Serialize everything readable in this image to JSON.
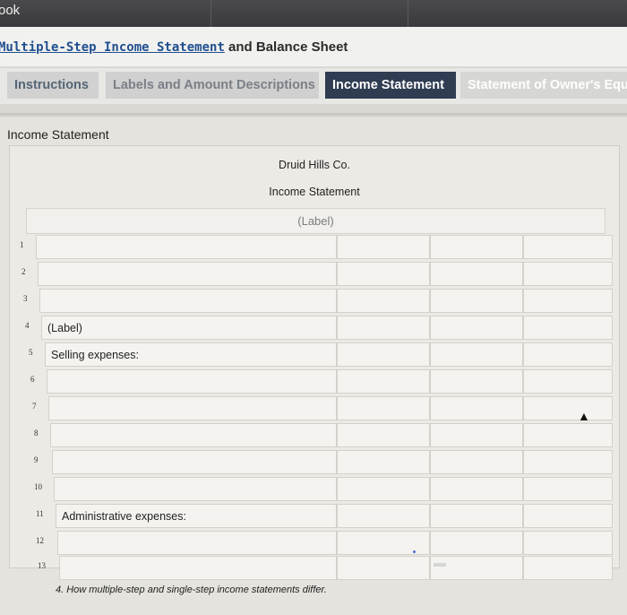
{
  "topbar": {
    "book_label": "ook"
  },
  "header": {
    "title_link": "Multiple-Step Income Statement",
    "title_rest": " and Balance Sheet"
  },
  "tabs": [
    {
      "label": "Instructions"
    },
    {
      "label": "Labels and Amount Descriptions"
    },
    {
      "label": "Income Statement"
    },
    {
      "label": "Statement of Owner's Equi"
    }
  ],
  "section": {
    "title": "Income Statement",
    "company": "Druid Hills Co.",
    "statement": "Income Statement",
    "header_label": "(Label)"
  },
  "rows": [
    {
      "num": "1",
      "text": ""
    },
    {
      "num": "2",
      "text": ""
    },
    {
      "num": "3",
      "text": ""
    },
    {
      "num": "4",
      "text": "(Label)"
    },
    {
      "num": "5",
      "text": "Selling expenses:"
    },
    {
      "num": "6",
      "text": ""
    },
    {
      "num": "7",
      "text": ""
    },
    {
      "num": "8",
      "text": ""
    },
    {
      "num": "9",
      "text": ""
    },
    {
      "num": "10",
      "text": ""
    },
    {
      "num": "11",
      "text": "Administrative expenses:"
    },
    {
      "num": "12",
      "text": ""
    },
    {
      "num": "13",
      "text": ""
    }
  ],
  "footer": {
    "text": "4. How multiple-step and single-step income statements differ."
  },
  "colors": {
    "active_tab": "#2f3c52",
    "link": "#1f4f8f"
  }
}
